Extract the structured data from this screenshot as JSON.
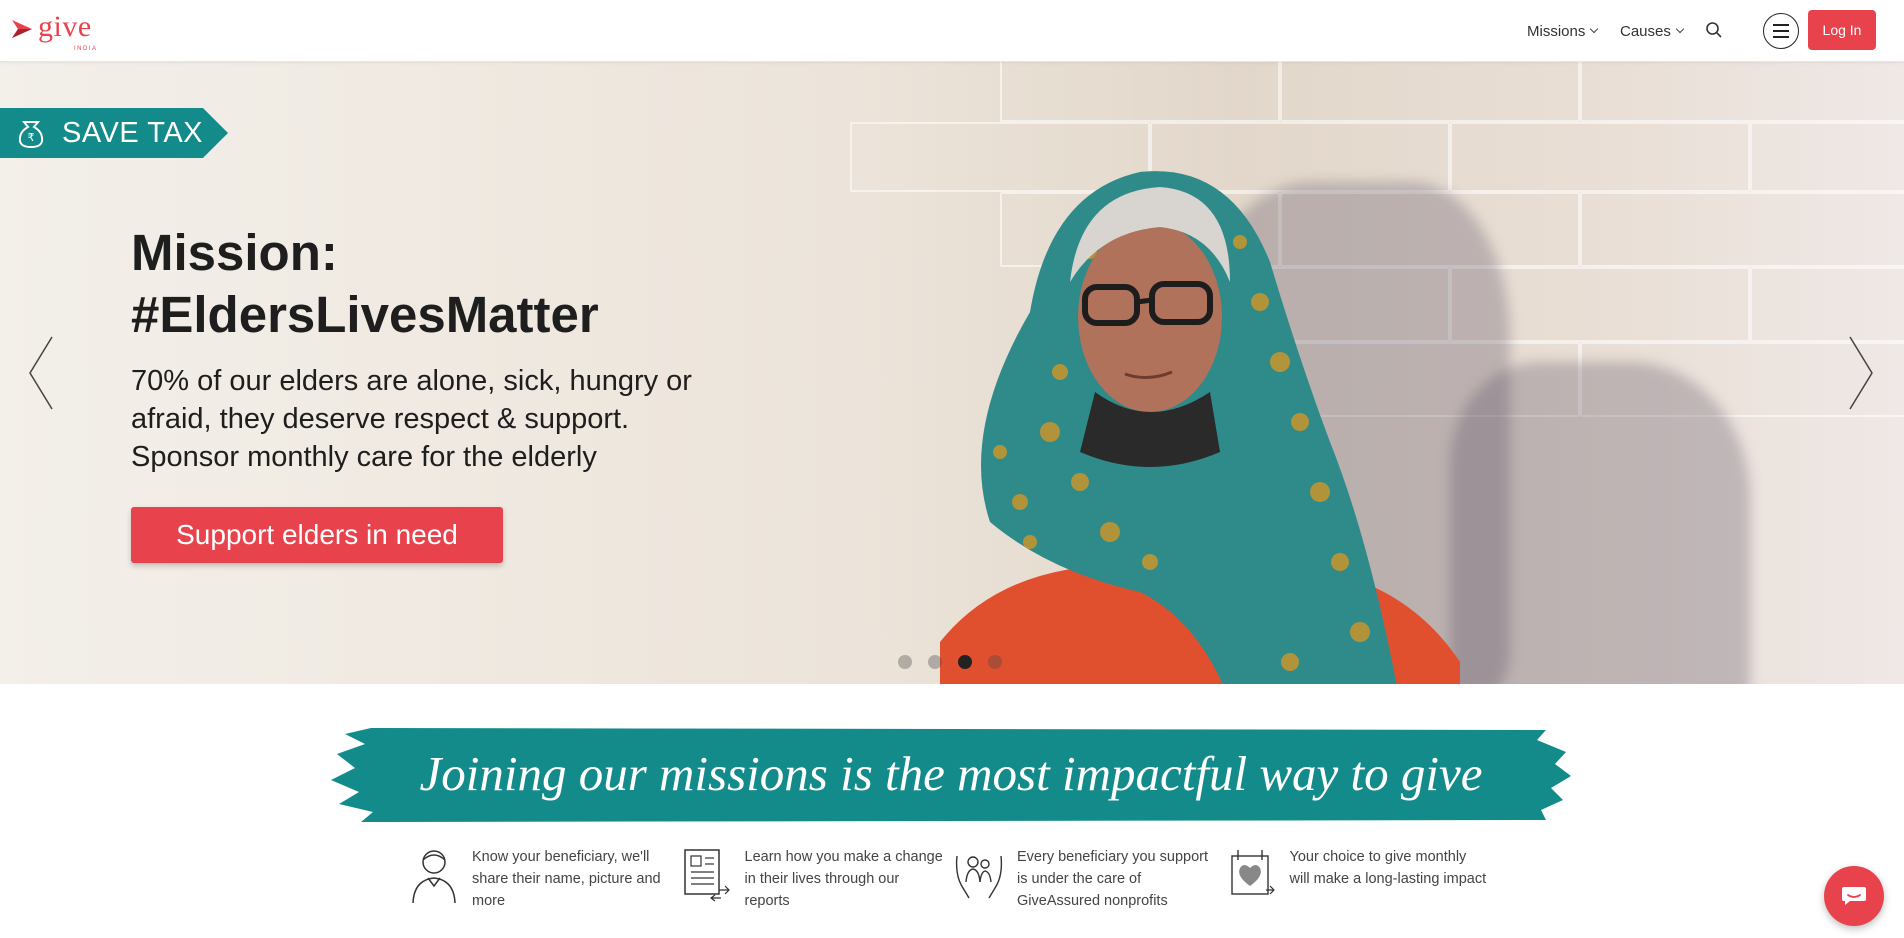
{
  "header": {
    "logo": {
      "wordmark": "give",
      "subtext": "INDIA",
      "icon": "give-logo-icon"
    },
    "nav": [
      {
        "label": "Missions",
        "icon": "chevron-down-icon"
      },
      {
        "label": "Causes",
        "icon": "chevron-down-icon"
      }
    ],
    "search_icon": "search-icon",
    "menu_icon": "hamburger-menu-icon",
    "login_label": "Log In"
  },
  "hero": {
    "badge": {
      "label": "SAVE TAX",
      "icon": "money-bag-icon"
    },
    "title_line1": "Mission:",
    "title_line2": "#EldersLivesMatter",
    "subtitle_line1": "70% of our elders are alone, sick, hungry or",
    "subtitle_line2": "afraid, they deserve respect & support.",
    "subtitle_line3": "Sponsor monthly care for the elderly",
    "cta_label": "Support elders in need",
    "prev_icon": "chevron-left-icon",
    "next_icon": "chevron-right-icon",
    "carousel": {
      "slide_count": 4,
      "active_index": 2
    }
  },
  "missions_banner": {
    "text": "Joining our missions is the most impactful way to give"
  },
  "features": [
    {
      "icon": "person-icon",
      "text": "Know your beneficiary, we'll share their name, picture and more"
    },
    {
      "icon": "report-icon",
      "text": "Learn how you make a change in their lives through our reports"
    },
    {
      "icon": "caring-hands-icon",
      "text": "Every beneficiary you support is under the care of GiveAssured nonprofits"
    },
    {
      "icon": "calendar-heart-icon",
      "text": "Your choice to give monthly will make a long-lasting impact"
    }
  ],
  "chat_icon": "chat-bubble-icon",
  "colors": {
    "brand_red": "#e8434c",
    "teal": "#138b8a",
    "text_dark": "#1e1e1e"
  }
}
